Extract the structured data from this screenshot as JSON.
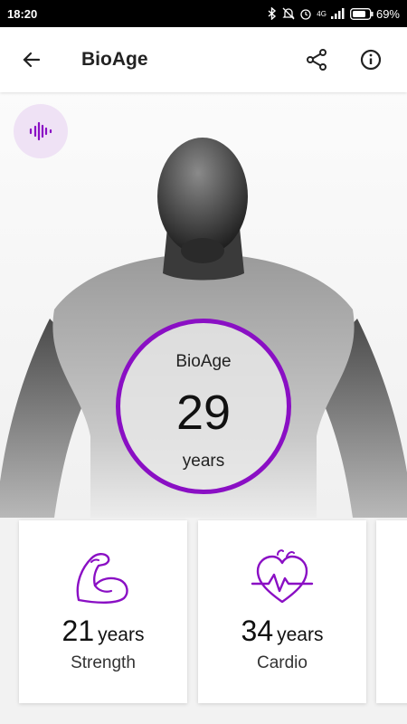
{
  "status_bar": {
    "time": "18:20",
    "network": "4G",
    "battery": "69%"
  },
  "app_bar": {
    "title": "BioAge"
  },
  "bioage": {
    "label": "BioAge",
    "value": "29",
    "unit": "years"
  },
  "cards": [
    {
      "value": "21",
      "unit": "years",
      "label": "Strength",
      "icon": "flexed-arm-icon"
    },
    {
      "value": "34",
      "unit": "years",
      "label": "Cardio",
      "icon": "heart-pulse-icon"
    }
  ],
  "colors": {
    "accent": "#8a0fc4",
    "accent_light": "#efe2f5"
  }
}
